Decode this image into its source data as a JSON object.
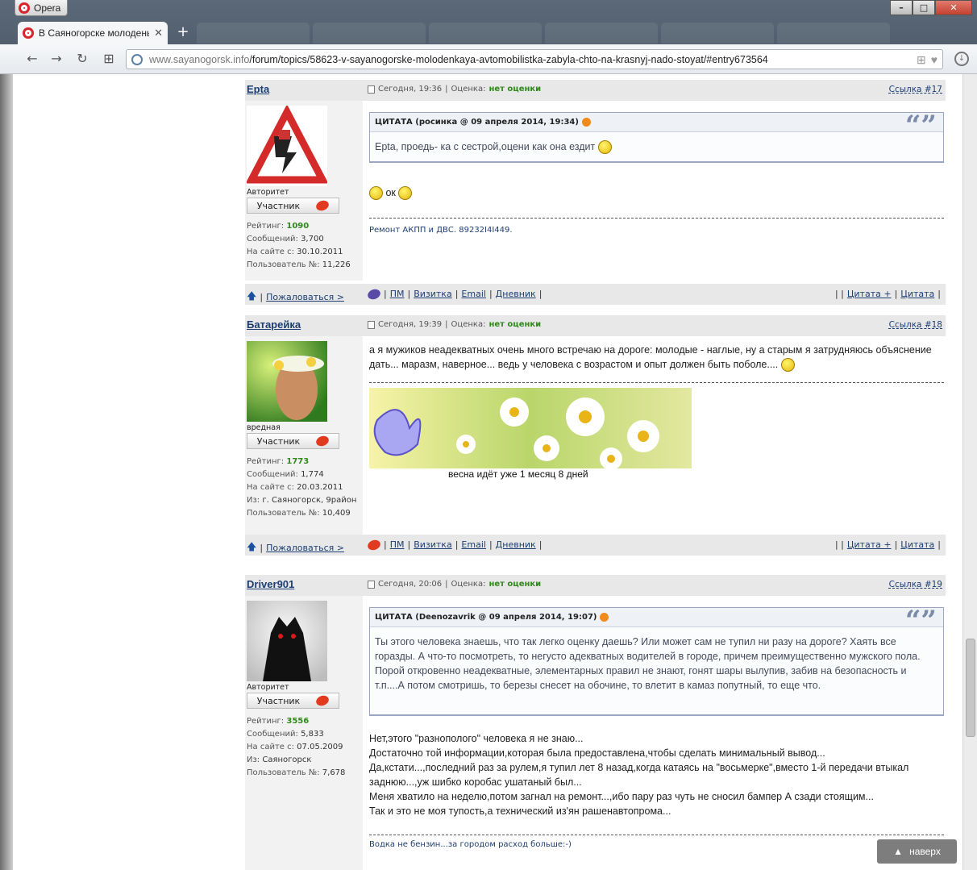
{
  "browser": {
    "menu_label": "Opera",
    "tab_title": "В Саяногорске молоденькая",
    "url_prefix": "www.sayanogorsk.info",
    "url_path": "/forum/topics/58623-v-sayanogorske-molodenkaya-avtomobilistka-zabyla-chto-na-krasnyj-nado-stoyat/#entry673564",
    "new_tab_symbol": "+",
    "window_controls": [
      "–",
      "□",
      "✕"
    ]
  },
  "posts": [
    {
      "author": "Epta",
      "time": "Сегодня, 19:36",
      "rating_label": "Оценка:",
      "rating_value": "нет оценки",
      "link": "Ссылка #17",
      "group": "Авторитет",
      "badge": "Участник",
      "stats": {
        "rating_label": "Рейтинг:",
        "rating": "1090",
        "messages_label": "Сообщений:",
        "messages": "3,700",
        "since_label": "На сайте с:",
        "since": "30.10.2011",
        "user_no_label": "Пользователь №:",
        "user_no": "11,226"
      },
      "quote": {
        "header": "ЦИТАТА (росинка @ 09 апреля 2014, 19:34)",
        "text": "Epta, проедь- ка с сестрой,оцени как она ездит"
      },
      "message": "ок",
      "signature": "Ремонт АКПП и ДВС. 89232I4I449.",
      "footer": {
        "report": "Пожаловаться >",
        "pm": "ПМ",
        "card": "Визитка",
        "email": "Email",
        "diary": "Дневник",
        "quote_plus": "Цитата +",
        "quote": "Цитата"
      }
    },
    {
      "author": "Батарейка",
      "time": "Сегодня, 19:39",
      "rating_label": "Оценка:",
      "rating_value": "нет оценки",
      "link": "Ссылка #18",
      "group": "вредная",
      "badge": "Участник",
      "stats": {
        "rating_label": "Рейтинг:",
        "rating": "1773",
        "messages_label": "Сообщений:",
        "messages": "1,774",
        "since_label": "На сайте с:",
        "since": "20.03.2011",
        "from_label": "Из:",
        "from": "г. Саяногорск, 9район",
        "user_no_label": "Пользователь №:",
        "user_no": "10,409"
      },
      "message": "а я мужиков неадекватных очень много встречаю на дороге: молодые - наглые, ну а старым я затрудняюсь объяснение дать... маразм, наверное... ведь у человека с возрастом и опыт должен быть поболе....",
      "banner_caption": "весна идёт уже 1 месяц 8 дней",
      "footer": {
        "report": "Пожаловаться >",
        "pm": "ПМ",
        "card": "Визитка",
        "email": "Email",
        "diary": "Дневник",
        "quote_plus": "Цитата +",
        "quote": "Цитата"
      }
    },
    {
      "author": "Driver901",
      "time": "Сегодня, 20:06",
      "rating_label": "Оценка:",
      "rating_value": "нет оценки",
      "link": "Ссылка #19",
      "group": "Авторитет",
      "badge": "Участник",
      "stats": {
        "rating_label": "Рейтинг:",
        "rating": "3556",
        "messages_label": "Сообщений:",
        "messages": "5,833",
        "since_label": "На сайте с:",
        "since": "07.05.2009",
        "from_label": "Из:",
        "from": "Саяногорск",
        "user_no_label": "Пользователь №:",
        "user_no": "7,678"
      },
      "quote": {
        "header": "ЦИТАТА (Deenozavrik @ 09 апреля 2014, 19:07)",
        "text": "Ты этого человека знаешь, что так легко оценку даешь? Или может сам не тупил ни разу на дороге? Хаять все горазды. А что-то посмотреть, то негусто адекватных водителей в городе, причем преимущественно мужского пола. Порой откровенно неадекватные, элементарных правил не знают, гонят шары вылупив, забив на безопасность и т.п....А потом смотришь, то березы снесет на обочине, то влетит в камаз попутный, то еще что."
      },
      "message_lines": [
        "Нет,этого \"разнополого\" человека я не знаю...",
        "Достаточно той информации,которая была предоставлена,чтобы сделать минимальный вывод...",
        "Да,кстати...,последний раз за рулем,я тупил лет 8 назад,когда катаясь на \"восьмерке\",вместо 1-й передачи втыкал заднюю...,уж шибко коробас ушатаный был...",
        "Меня хватило на неделю,потом загнал на ремонт...,ибо пару раз чуть не сносил бампер А сзади стоящим...",
        "Так и это не моя тупость,а технический из'ян рашенавтопрома..."
      ],
      "signature": "Водка не бензин...за городом расход больше:-)"
    }
  ],
  "scroll_top": "наверх",
  "colors": {
    "link": "#1c3e73",
    "rating_green": "#2f8a19",
    "header_bg": "#e8e8e8"
  }
}
